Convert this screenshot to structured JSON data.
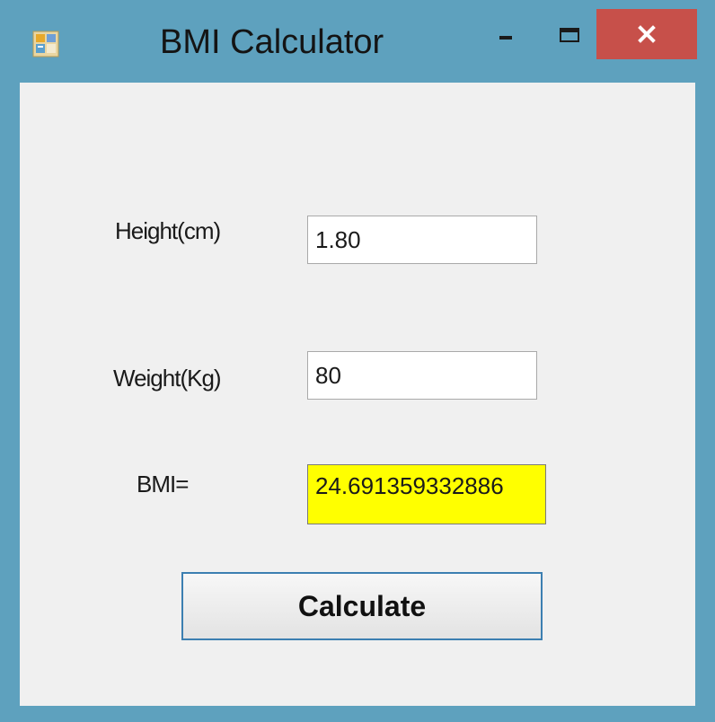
{
  "window": {
    "title": "BMI Calculator",
    "controls": {
      "minimize_icon": "minimize-icon",
      "maximize_icon": "maximize-icon",
      "close_icon": "close-icon",
      "close_color": "#c7504a"
    },
    "frame_color": "#5ea1be"
  },
  "form": {
    "height_label": "Height(cm)",
    "height_value": "1.80",
    "weight_label": "Weight(Kg)",
    "weight_value": "80",
    "bmi_label": "BMI=",
    "bmi_value": "24.691359332886",
    "bmi_highlight": "#ffff00",
    "calculate_label": "Calculate"
  }
}
